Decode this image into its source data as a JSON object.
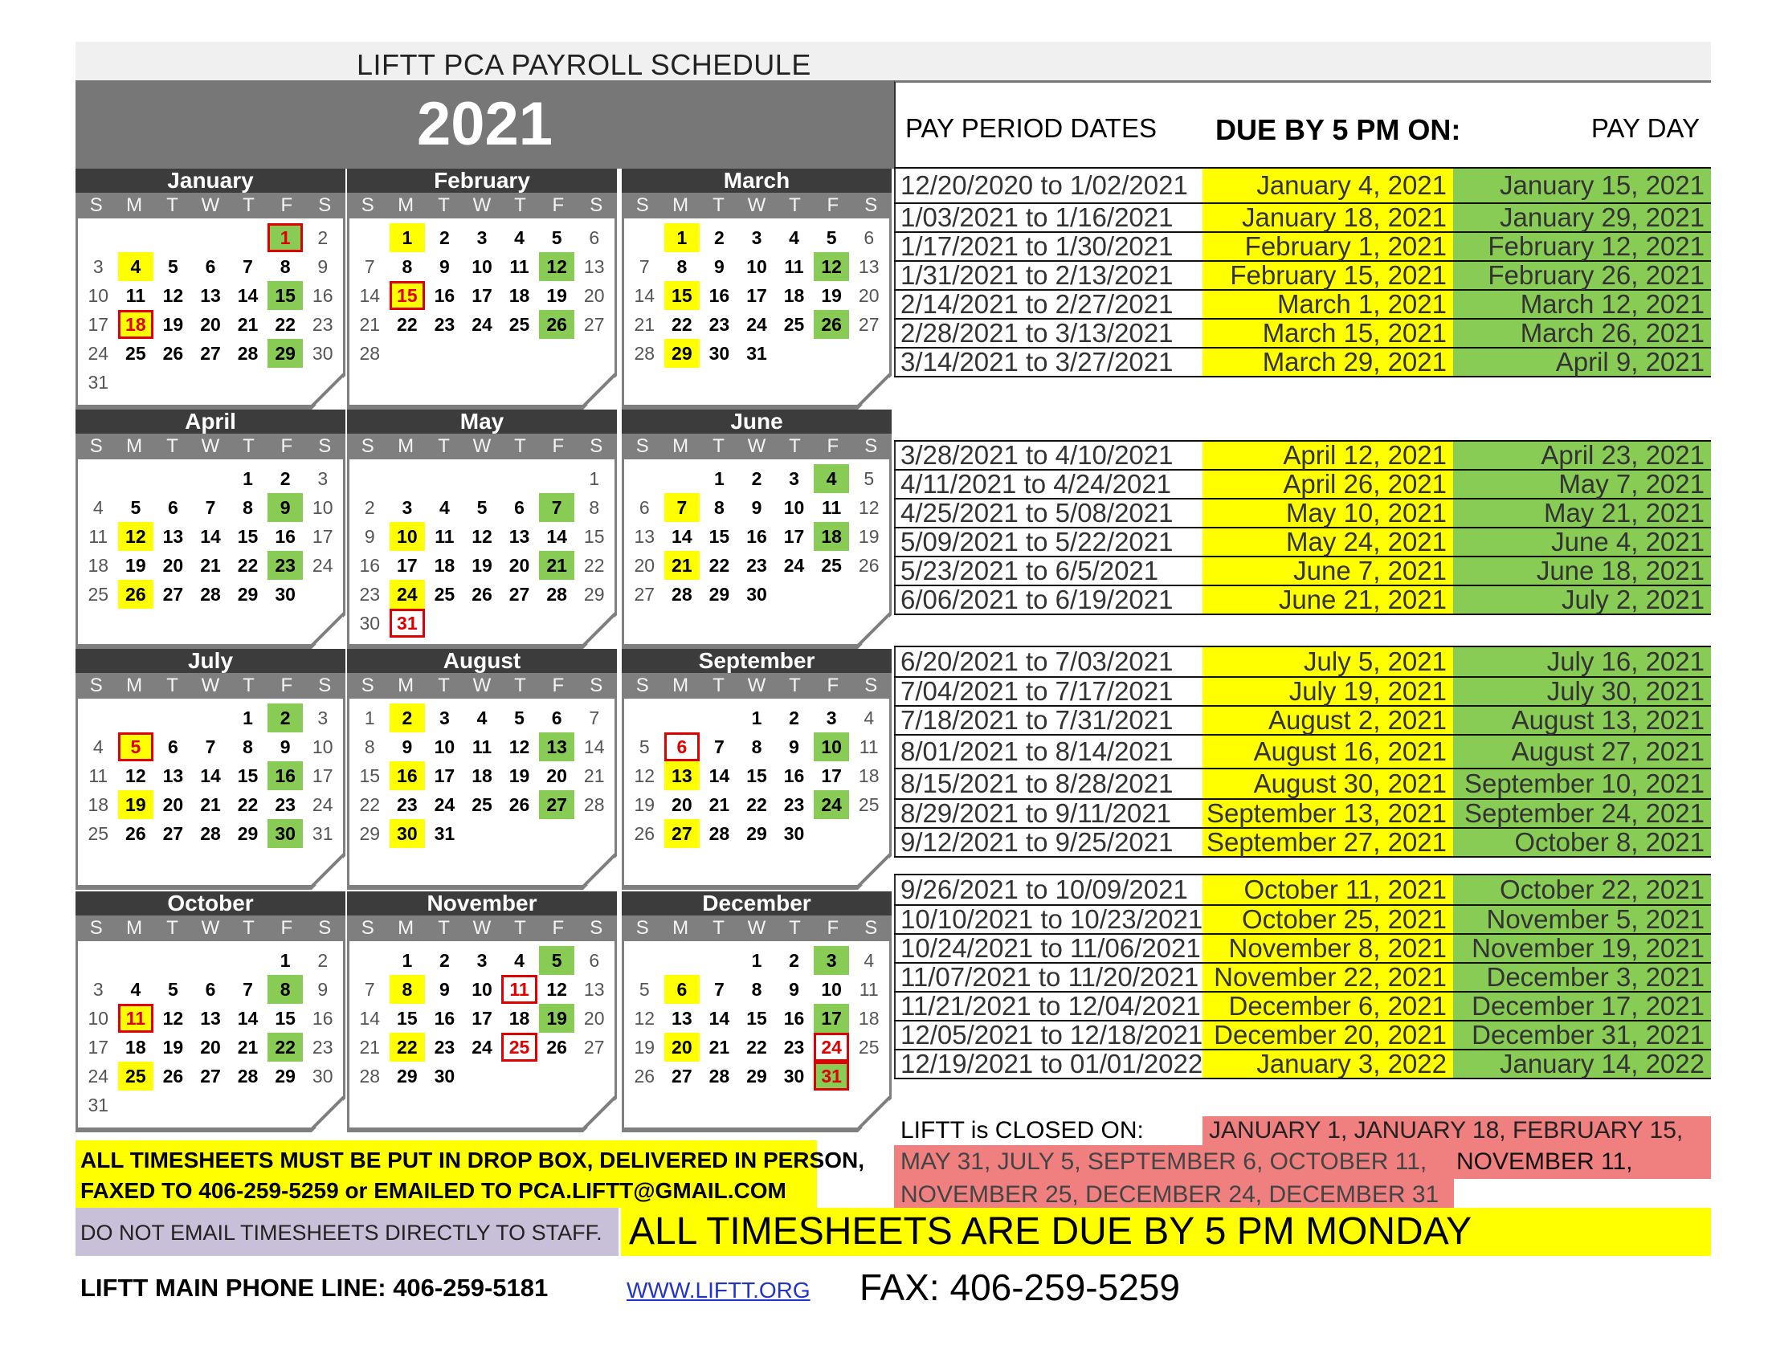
{
  "title": "LIFTT PCA PAYROLL SCHEDULE",
  "year": "2021",
  "table_headers": {
    "pay_period": "PAY PERIOD DATES",
    "due": "DUE BY 5 PM ON:",
    "pay_day": "PAY DAY"
  },
  "weekday_labels": [
    "S",
    "M",
    "T",
    "W",
    "T",
    "F",
    "S"
  ],
  "legend_colors": {
    "due_date": "#ffff00",
    "pay_day": "#88cc55",
    "closed": "#f08080",
    "closed_border": "#e00000"
  },
  "months": [
    {
      "name": "January",
      "start": 5,
      "days": 31,
      "due": [
        4,
        18
      ],
      "pay": [
        1,
        15,
        29
      ],
      "closed": [
        1,
        18
      ]
    },
    {
      "name": "February",
      "start": 1,
      "days": 28,
      "due": [
        1,
        15
      ],
      "pay": [
        12,
        26
      ],
      "closed": [
        15
      ]
    },
    {
      "name": "March",
      "start": 1,
      "days": 31,
      "due": [
        1,
        15,
        29
      ],
      "pay": [
        12,
        26
      ],
      "closed": []
    },
    {
      "name": "April",
      "start": 4,
      "days": 30,
      "due": [
        12,
        26
      ],
      "pay": [
        9,
        23
      ],
      "closed": []
    },
    {
      "name": "May",
      "start": 6,
      "days": 31,
      "due": [
        10,
        24
      ],
      "pay": [
        7,
        21
      ],
      "closed": [
        31
      ]
    },
    {
      "name": "June",
      "start": 2,
      "days": 30,
      "due": [
        7,
        21
      ],
      "pay": [
        4,
        18
      ],
      "closed": []
    },
    {
      "name": "July",
      "start": 4,
      "days": 31,
      "due": [
        5,
        19
      ],
      "pay": [
        2,
        16,
        30
      ],
      "closed": [
        5
      ]
    },
    {
      "name": "August",
      "start": 0,
      "days": 31,
      "due": [
        2,
        16,
        30
      ],
      "pay": [
        13,
        27
      ],
      "closed": []
    },
    {
      "name": "September",
      "start": 3,
      "days": 30,
      "due": [
        13,
        27
      ],
      "pay": [
        10,
        24
      ],
      "closed": [
        6
      ]
    },
    {
      "name": "October",
      "start": 5,
      "days": 31,
      "due": [
        11,
        25
      ],
      "pay": [
        8,
        22
      ],
      "closed": [
        11
      ]
    },
    {
      "name": "November",
      "start": 1,
      "days": 30,
      "due": [
        8,
        22
      ],
      "pay": [
        5,
        19
      ],
      "closed": [
        11,
        25
      ]
    },
    {
      "name": "December",
      "start": 3,
      "days": 31,
      "due": [
        6,
        20
      ],
      "pay": [
        3,
        17,
        31
      ],
      "closed": [
        24,
        31
      ]
    }
  ],
  "pay_periods": [
    {
      "period": "12/20/2020 to 1/02/2021",
      "due": "January 4, 2021",
      "pay": "January 15, 2021"
    },
    {
      "period": "1/03/2021 to 1/16/2021",
      "due": "January 18, 2021",
      "pay": "January 29, 2021"
    },
    {
      "period": "1/17/2021 to 1/30/2021",
      "due": "February 1, 2021",
      "pay": "February 12, 2021"
    },
    {
      "period": "1/31/2021 to 2/13/2021",
      "due": "February 15, 2021",
      "pay": "February 26, 2021"
    },
    {
      "period": "2/14/2021 to 2/27/2021",
      "due": "March 1, 2021",
      "pay": "March 12, 2021"
    },
    {
      "period": "2/28/2021 to 3/13/2021",
      "due": "March 15, 2021",
      "pay": "March 26, 2021"
    },
    {
      "period": "3/14/2021 to 3/27/2021",
      "due": "March 29, 2021",
      "pay": "April 9, 2021"
    },
    {
      "period": "3/28/2021 to 4/10/2021",
      "due": "April 12, 2021",
      "pay": "April 23, 2021"
    },
    {
      "period": "4/11/2021 to 4/24/2021",
      "due": "April 26, 2021",
      "pay": "May 7, 2021"
    },
    {
      "period": "4/25/2021 to 5/08/2021",
      "due": "May 10, 2021",
      "pay": "May 21, 2021"
    },
    {
      "period": "5/09/2021 to 5/22/2021",
      "due": "May 24, 2021",
      "pay": "June 4, 2021"
    },
    {
      "period": "5/23/2021 to 6/5/2021",
      "due": "June 7, 2021",
      "pay": "June 18, 2021"
    },
    {
      "period": "6/06/2021 to 6/19/2021",
      "due": "June 21, 2021",
      "pay": "July 2, 2021"
    },
    {
      "period": "6/20/2021 to 7/03/2021",
      "due": "July 5, 2021",
      "pay": "July 16, 2021"
    },
    {
      "period": "7/04/2021 to 7/17/2021",
      "due": "July 19, 2021",
      "pay": "July 30, 2021"
    },
    {
      "period": "7/18/2021 to 7/31/2021",
      "due": "August 2, 2021",
      "pay": "August 13, 2021"
    },
    {
      "period": "8/01/2021 to 8/14/2021",
      "due": "August 16, 2021",
      "pay": "August 27, 2021"
    },
    {
      "period": "8/15/2021 to 8/28/2021",
      "due": "August 30, 2021",
      "pay": "September 10, 2021"
    },
    {
      "period": "8/29/2021 to 9/11/2021",
      "due": "September 13, 2021",
      "pay": "September 24, 2021"
    },
    {
      "period": "9/12/2021 to 9/25/2021",
      "due": "September 27, 2021",
      "pay": "October 8, 2021"
    },
    {
      "period": "9/26/2021 to 10/09/2021",
      "due": "October 11, 2021",
      "pay": "October 22, 2021"
    },
    {
      "period": "10/10/2021 to 10/23/2021",
      "due": "October 25, 2021",
      "pay": "November 5, 2021"
    },
    {
      "period": "10/24/2021 to 11/06/2021",
      "due": "November 8, 2021",
      "pay": "November 19, 2021"
    },
    {
      "period": "11/07/2021 to 11/20/2021",
      "due": "November 22, 2021",
      "pay": "December 3, 2021"
    },
    {
      "period": "11/21/2021 to 12/04/2021",
      "due": "December 6, 2021",
      "pay": "December 17, 2021"
    },
    {
      "period": "12/05/2021 to 12/18/2021",
      "due": "December 20, 2021",
      "pay": "December 31, 2021"
    },
    {
      "period": "12/19/2021 to 01/01/2022",
      "due": "January 3, 2022",
      "pay": "January 14, 2022"
    }
  ],
  "closed": {
    "label": "LIFTT is CLOSED ON:",
    "line1": "JANUARY 1, JANUARY 18, FEBRUARY 15,",
    "line2": "MAY 31, JULY 5, SEPTEMBER 6, OCTOBER 11,",
    "line2b": "NOVEMBER 11,",
    "line3": "NOVEMBER 25, DECEMBER 24, DECEMBER 31"
  },
  "footer": {
    "notice_line1": "ALL TIMESHEETS MUST BE PUT IN DROP BOX, DELIVERED IN PERSON,",
    "notice_line2": "FAXED TO 406-259-5259 or EMAILED TO PCA.LIFTT@GMAIL.COM",
    "no_email": "DO NOT EMAIL TIMESHEETS DIRECTLY TO STAFF.",
    "due_banner": "ALL TIMESHEETS ARE DUE BY 5 PM MONDAY",
    "phone": "LIFTT MAIN PHONE LINE: 406-259-5181",
    "website": "WWW.LIFTT.ORG",
    "fax": "FAX: 406-259-5259"
  }
}
